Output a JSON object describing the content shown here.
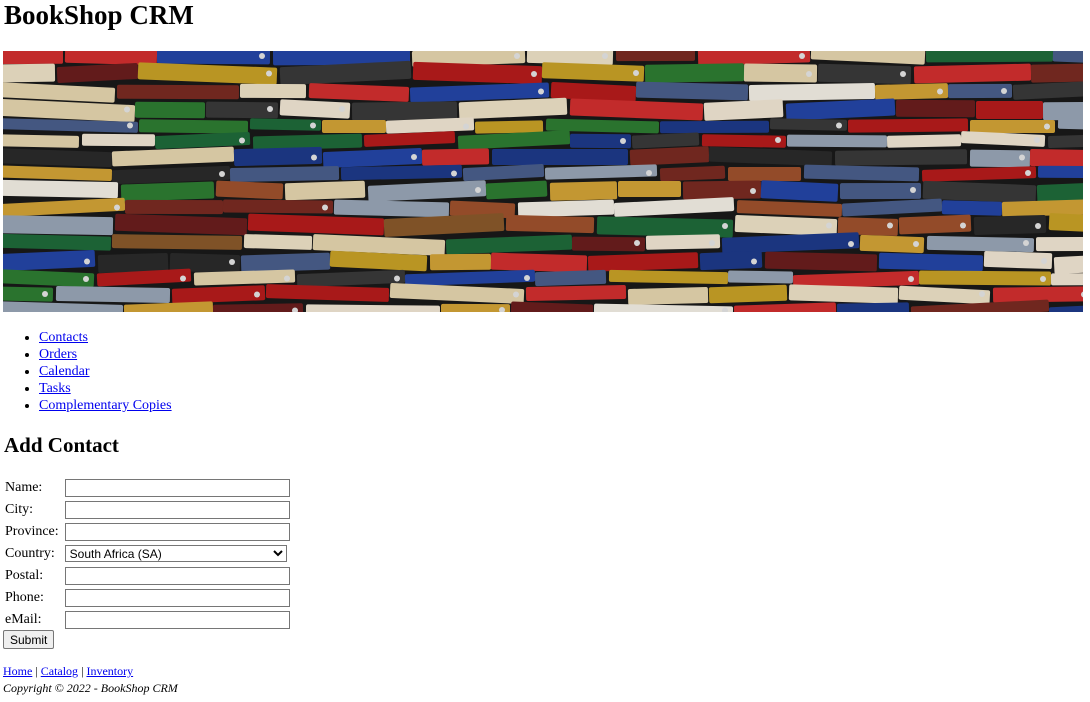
{
  "header": {
    "title": "BookShop CRM"
  },
  "banner": {
    "alt": "books-banner-image"
  },
  "nav": {
    "items": [
      {
        "label": "Contacts"
      },
      {
        "label": "Orders"
      },
      {
        "label": "Calendar"
      },
      {
        "label": "Tasks"
      },
      {
        "label": "Complementary Copies"
      }
    ]
  },
  "form": {
    "heading": "Add Contact",
    "fields": {
      "name": {
        "label": "Name:",
        "value": ""
      },
      "city": {
        "label": "City:",
        "value": ""
      },
      "province": {
        "label": "Province:",
        "value": ""
      },
      "country": {
        "label": "Country:",
        "selected": "South Africa (SA)"
      },
      "postal": {
        "label": "Postal:",
        "value": ""
      },
      "phone": {
        "label": "Phone:",
        "value": ""
      },
      "email": {
        "label": "eMail:",
        "value": ""
      }
    },
    "submit_label": "Submit"
  },
  "footer": {
    "links": [
      {
        "label": "Home"
      },
      {
        "label": "Catalog"
      },
      {
        "label": "Inventory"
      }
    ],
    "separator": "|",
    "copyright": "Copyright © 2022 - BookShop CRM"
  }
}
